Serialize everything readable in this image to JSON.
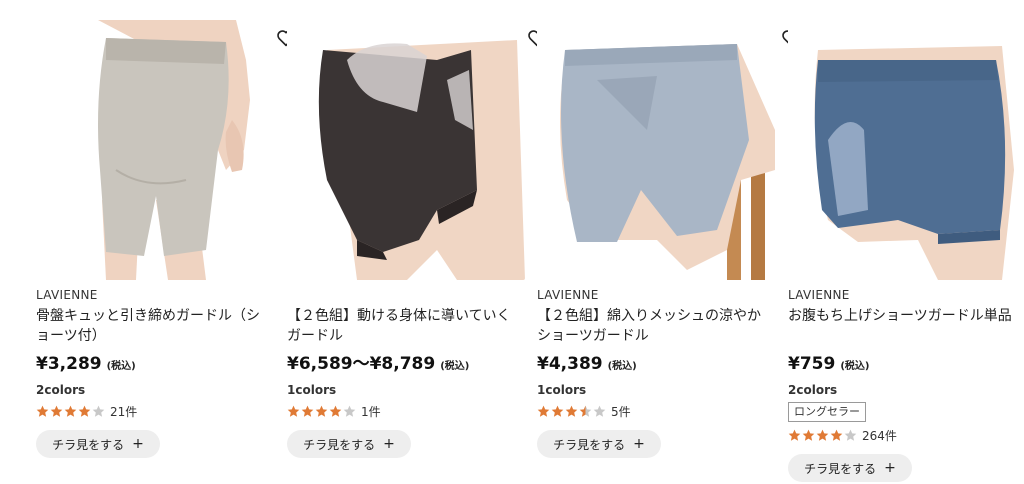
{
  "products": [
    {
      "brand": "LAVIENNE",
      "name": "骨盤キュッと引き締めガードル（ショーツ付）",
      "price": "¥3,289",
      "tax": "(税込)",
      "colors": "2colors",
      "badge": "",
      "rating_value": 4.0,
      "review_count": "21件",
      "peek_label": "チラ見をする",
      "garment_color": "#c9c5bd"
    },
    {
      "brand": "",
      "name": "【２色組】動ける身体に導いていくガードル",
      "price": "¥6,589～¥8,789",
      "tax": "(税込)",
      "colors": "1colors",
      "badge": "",
      "rating_value": 4.0,
      "review_count": "1件",
      "peek_label": "チラ見をする",
      "garment_color": "#3a3434"
    },
    {
      "brand": "LAVIENNE",
      "name": "【２色組】綿入りメッシュの涼やかショーツガードル",
      "price": "¥4,389",
      "tax": "(税込)",
      "colors": "1colors",
      "badge": "",
      "rating_value": 3.5,
      "review_count": "5件",
      "peek_label": "チラ見をする",
      "garment_color": "#a9b6c6"
    },
    {
      "brand": "LAVIENNE",
      "name": "お腹もち上げショーツガードル単品",
      "price": "¥759",
      "tax": "(税込)",
      "colors": "2colors",
      "badge": "ロングセラー",
      "rating_value": 4.0,
      "review_count": "264件",
      "peek_label": "チラ見をする",
      "garment_color": "#4f6e93"
    }
  ],
  "icons": {
    "favorite": "heart-outline-icon",
    "star": "star-icon",
    "plus": "plus-icon"
  },
  "colors": {
    "star_filled": "#e07a35",
    "star_empty": "#c8c8c8",
    "peek_bg": "#eeeeee",
    "skin": "#f0d6c4"
  }
}
